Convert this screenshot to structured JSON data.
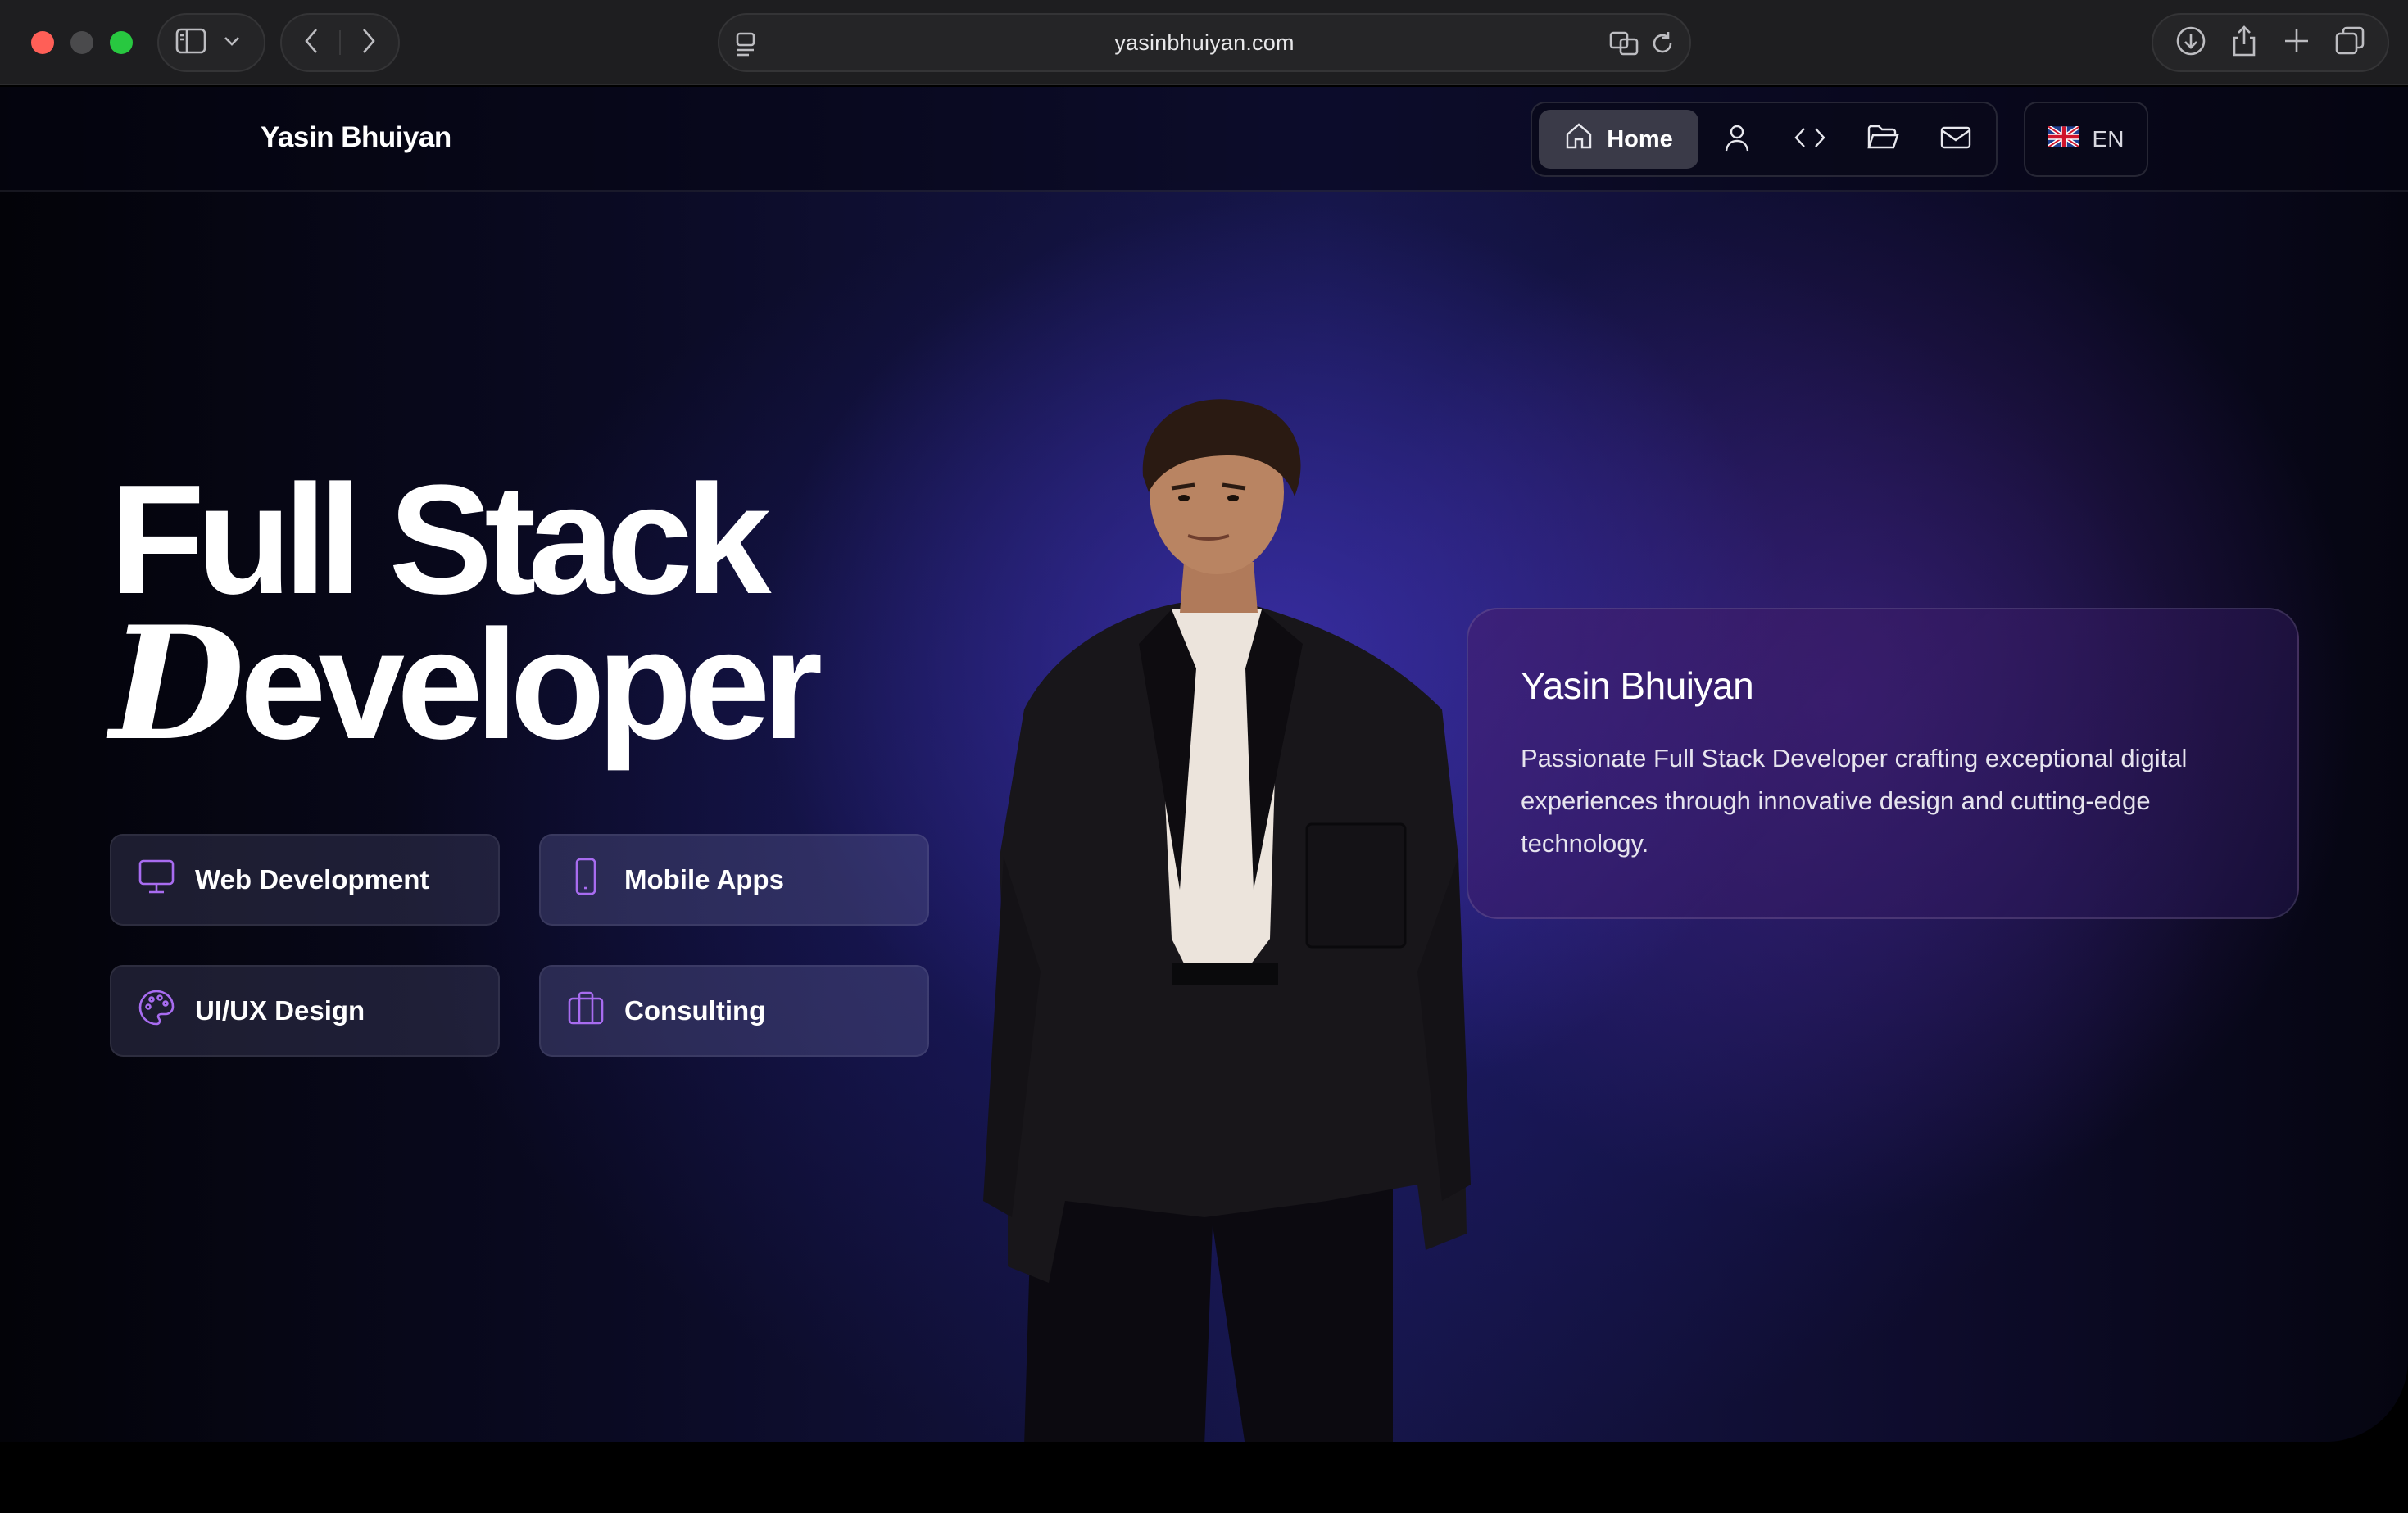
{
  "browser": {
    "url": "yasinbhuiyan.com"
  },
  "header": {
    "brand": "Yasin Bhuiyan",
    "nav": {
      "home_label": "Home",
      "items": [
        "user-icon",
        "code-icon",
        "folder-icon",
        "mail-icon"
      ]
    },
    "language": "EN"
  },
  "hero": {
    "title_line1": "Full Stack",
    "title_line2_first": "D",
    "title_line2_rest": "eveloper"
  },
  "services": [
    {
      "label": "Web Development",
      "icon": "monitor-icon"
    },
    {
      "label": "Mobile Apps",
      "icon": "smartphone-icon"
    },
    {
      "label": "UI/UX Design",
      "icon": "palette-icon"
    },
    {
      "label": "Consulting",
      "icon": "briefcase-icon"
    }
  ],
  "profile_card": {
    "name": "Yasin Bhuiyan",
    "description": "Passionate Full Stack Developer crafting exceptional digital experiences through innovative design and cutting-edge technology."
  },
  "colors": {
    "accent": "#a86cf0",
    "traffic_red": "#ff5f57",
    "traffic_green": "#28c840"
  }
}
